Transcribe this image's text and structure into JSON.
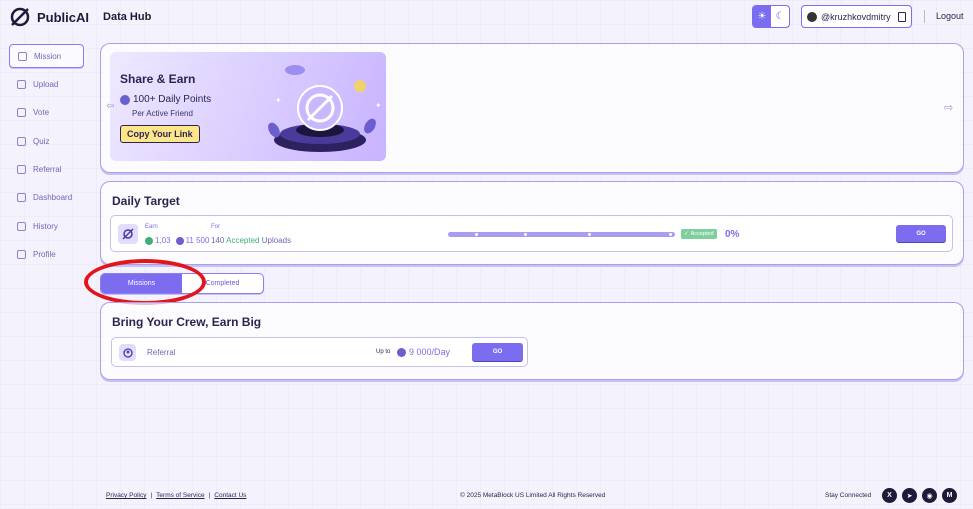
{
  "header": {
    "brand": "PublicAI",
    "section": "Data Hub",
    "theme_light": "☀",
    "theme_dark": "☾",
    "username": "@kruzhkovdmitry",
    "logout": "Logout"
  },
  "sidebar": {
    "items": [
      {
        "label": "Mission",
        "icon": "mission-icon"
      },
      {
        "label": "Upload",
        "icon": "upload-icon"
      },
      {
        "label": "Vote",
        "icon": "vote-icon"
      },
      {
        "label": "Quiz",
        "icon": "quiz-icon"
      },
      {
        "label": "Referral",
        "icon": "referral-icon"
      },
      {
        "label": "Dashboard",
        "icon": "dashboard-icon"
      },
      {
        "label": "History",
        "icon": "history-icon"
      },
      {
        "label": "Profile",
        "icon": "profile-icon"
      }
    ]
  },
  "banner": {
    "title": "Share & Earn",
    "points": "100+ Daily Points",
    "sub": "Per Active Friend",
    "cta": "Copy Your Link",
    "prev": "⇦",
    "next": "⇨"
  },
  "daily_target": {
    "title": "Daily Target",
    "earn_label": "Earn",
    "for_label": "For",
    "earn_green": "1,03",
    "earn_purple": "11 500",
    "for_count": "140",
    "for_accepted": "Accepted",
    "for_uploads": "Uploads",
    "progress": 0,
    "status": "Accepted",
    "percent": "0%",
    "go": "GO"
  },
  "tabs": {
    "missions": "Missions",
    "completed": "Completed"
  },
  "crew": {
    "title": "Bring Your Crew, Earn Big",
    "item_label": "Referral",
    "upto": "Up to",
    "amount": "9 000/Day",
    "go": "GO"
  },
  "footer": {
    "privacy": "Privacy Policy",
    "terms": "Terms of Service",
    "contact": "Contact Us",
    "sep": "|",
    "copyright": "© 2025 MetaBlock US Limited All Rights Reserved",
    "stay": "Stay Connected",
    "socials": [
      "X",
      "➤",
      "◉",
      "M"
    ]
  },
  "colors": {
    "accent": "#7b6cf0",
    "highlight_circle": "#e3151c",
    "success": "#3fae7a",
    "cta_yellow": "#fde58a"
  }
}
